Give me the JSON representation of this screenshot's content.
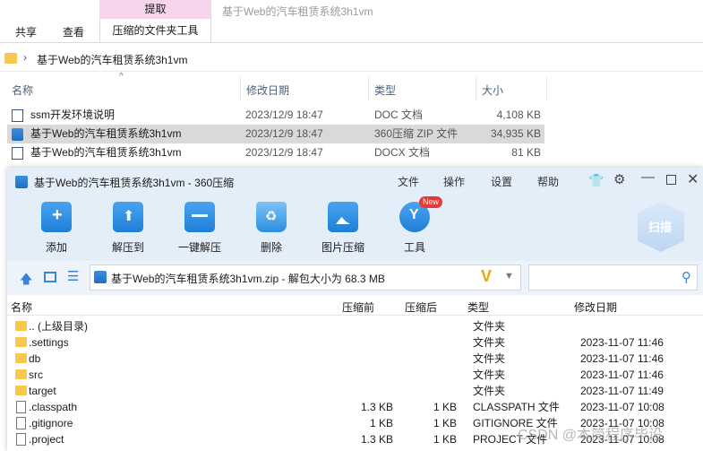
{
  "explorer": {
    "ribbon": {
      "contextual_tab": "提取",
      "window_title": "基于Web的汽车租赁系统3h1vm",
      "tabs": [
        "共享",
        "查看",
        "压缩的文件夹工具"
      ]
    },
    "address": {
      "path": "基于Web的汽车租赁系统3h1vm"
    },
    "columns": {
      "name": "名称",
      "modified": "修改日期",
      "type": "类型",
      "size": "大小"
    },
    "files": [
      {
        "name": "ssm开发环境说明",
        "modified": "2023/12/9 18:47",
        "type": "DOC 文档",
        "size": "4,108 KB",
        "selected": false
      },
      {
        "name": "基于Web的汽车租赁系统3h1vm",
        "modified": "2023/12/9 18:47",
        "type": "360压缩 ZIP 文件",
        "size": "34,935 KB",
        "selected": true
      },
      {
        "name": "基于Web的汽车租赁系统3h1vm",
        "modified": "2023/12/9 18:47",
        "type": "DOCX 文档",
        "size": "81 KB",
        "selected": false
      }
    ]
  },
  "zip_window": {
    "title": "基于Web的汽车租赁系统3h1vm - 360压缩",
    "menu": [
      "文件",
      "操作",
      "设置",
      "帮助"
    ],
    "scan_label": "扫描",
    "new_badge": "New",
    "tools": [
      {
        "label": "添加",
        "icon": "add-icon"
      },
      {
        "label": "解压到",
        "icon": "extract-to-icon"
      },
      {
        "label": "一键解压",
        "icon": "one-click-extract-icon"
      },
      {
        "label": "删除",
        "icon": "delete-icon"
      },
      {
        "label": "图片压缩",
        "icon": "image-compress-icon"
      },
      {
        "label": "工具",
        "icon": "tools-icon"
      }
    ],
    "path_text": "基于Web的汽车租赁系统3h1vm.zip - 解包大小为 68.3 MB",
    "columns": {
      "name": "名称",
      "compressed_before": "压缩前",
      "compressed_after": "压缩后",
      "type": "类型",
      "modified": "修改日期"
    },
    "rows": [
      {
        "name": ".. (上级目录)",
        "before": "",
        "after": "",
        "type": "文件夹",
        "modified": "",
        "kind": "folder"
      },
      {
        "name": ".settings",
        "before": "",
        "after": "",
        "type": "文件夹",
        "modified": "2023-11-07 11:46",
        "kind": "folder"
      },
      {
        "name": "db",
        "before": "",
        "after": "",
        "type": "文件夹",
        "modified": "2023-11-07 11:46",
        "kind": "folder"
      },
      {
        "name": "src",
        "before": "",
        "after": "",
        "type": "文件夹",
        "modified": "2023-11-07 11:46",
        "kind": "folder"
      },
      {
        "name": "target",
        "before": "",
        "after": "",
        "type": "文件夹",
        "modified": "2023-11-07 11:49",
        "kind": "folder"
      },
      {
        "name": ".classpath",
        "before": "1.3 KB",
        "after": "1 KB",
        "type": "CLASSPATH 文件",
        "modified": "2023-11-07 10:08",
        "kind": "file"
      },
      {
        "name": ".gitignore",
        "before": "1 KB",
        "after": "1 KB",
        "type": "GITIGNORE 文件",
        "modified": "2023-11-07 10:08",
        "kind": "file"
      },
      {
        "name": ".project",
        "before": "1.3 KB",
        "after": "1 KB",
        "type": "PROJECT 文件",
        "modified": "2023-11-07 10:08",
        "kind": "file"
      }
    ]
  },
  "watermark": "CSDN @本简程序毕设",
  "colors": {
    "accent": "#1f7fd6",
    "ribbon_context": "#f6d5ec",
    "selection": "#d9d9d9",
    "folder": "#f8c74f"
  }
}
